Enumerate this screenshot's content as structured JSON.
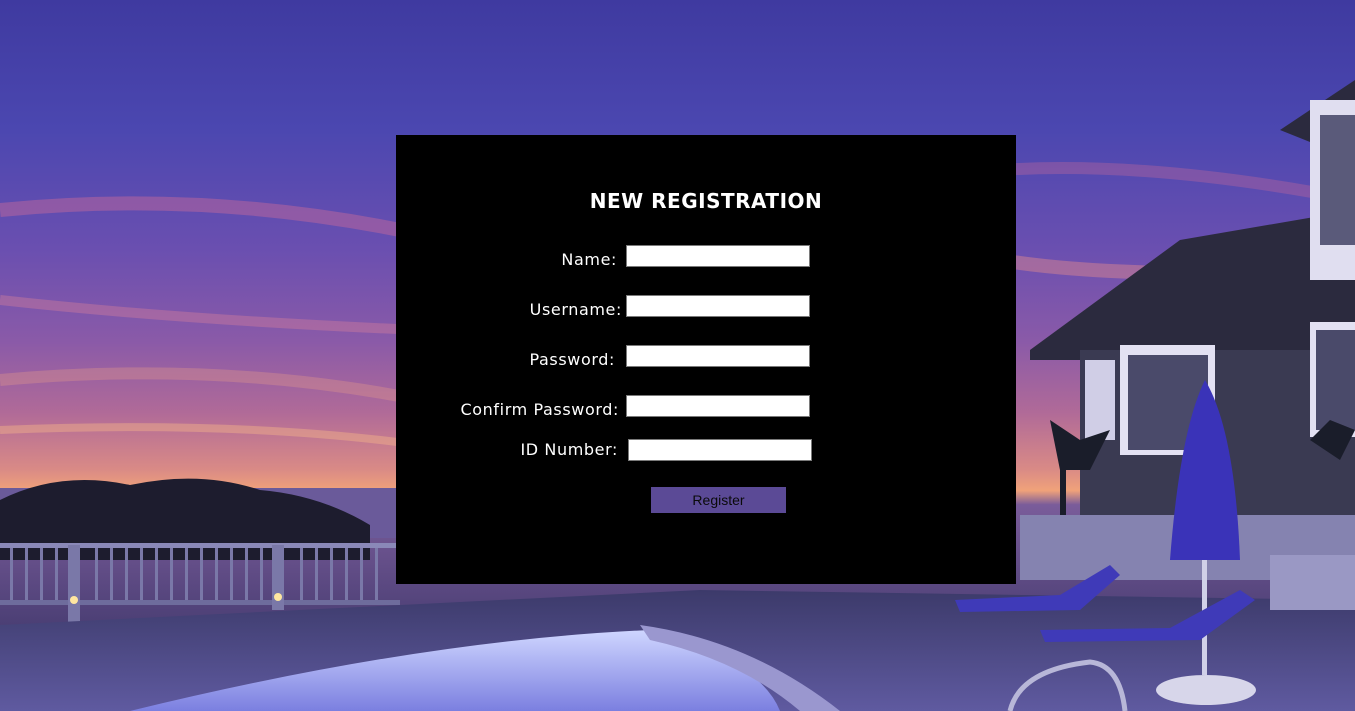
{
  "form": {
    "title": "NEW REGISTRATION",
    "fields": [
      {
        "label": "Name:",
        "value": "",
        "placeholder": ""
      },
      {
        "label": "Username:",
        "value": "",
        "placeholder": ""
      },
      {
        "label": "Password:",
        "value": "",
        "placeholder": ""
      },
      {
        "label": "Confirm Password:",
        "value": "",
        "placeholder": ""
      },
      {
        "label": "ID Number:",
        "value": "",
        "placeholder": ""
      }
    ],
    "submit_label": "Register"
  },
  "colors": {
    "panel_background": "#000000",
    "button_background": "#5b4a96",
    "text": "#ffffff"
  }
}
